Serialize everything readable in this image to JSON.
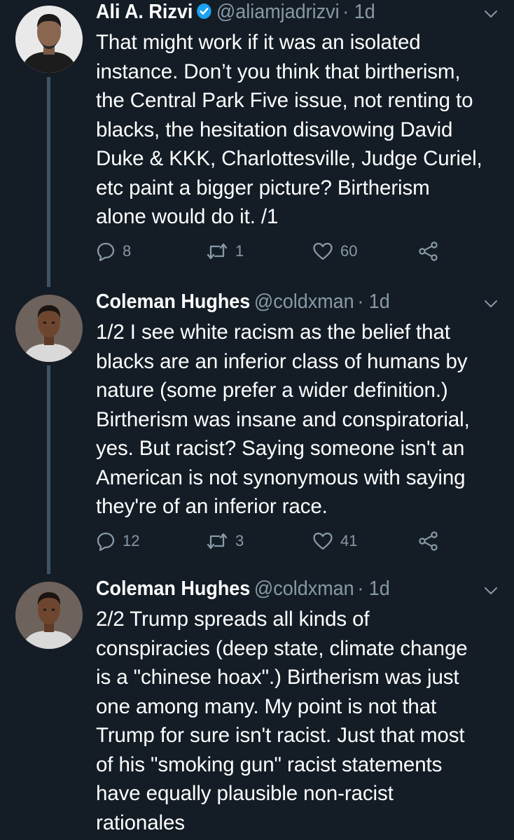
{
  "tweets": [
    {
      "name": "Ali A. Rizvi",
      "verified": true,
      "handle": "@aliamjadrizvi",
      "time": "· 1d",
      "text": "That might work if it was an isolated\ninstance. Don’t you think that birtherism,\nthe Central Park Five issue, not renting to\nblacks, the hesitation disavowing David\nDuke & KKK, Charlottesville, Judge Curiel,\netc paint a bigger picture? Birtherism\nalone would do it. /1",
      "replies": "8",
      "retweets": "1",
      "likes": "60"
    },
    {
      "name": "Coleman Hughes",
      "verified": false,
      "handle": "@coldxman",
      "time": "· 1d",
      "text": "1/2 I see white racism as the belief that\nblacks are an inferior class of humans by\nnature (some prefer a wider definition.)\nBirtherism was insane and conspiratorial,\nyes. But racist? Saying someone isn't an\nAmerican is not synonymous with saying\nthey're of an inferior race.",
      "replies": "12",
      "retweets": "3",
      "likes": "41"
    },
    {
      "name": "Coleman Hughes",
      "verified": false,
      "handle": "@coldxman",
      "time": "· 1d",
      "text": "2/2 Trump spreads all kinds of\nconspiracies (deep state, climate change\nis a \"chinese hoax\".) Birtherism was just\none among many. My point is not that\nTrump for sure isn't racist. Just that most\nof his \"smoking gun\" racist statements\nhave equally plausible non-racist\nrationales"
    }
  ],
  "colors": {
    "background": "#141d26",
    "text": "#ffffff",
    "muted": "#8899a6",
    "thread_line": "#3d5466",
    "verified": "#1da1f2"
  },
  "icons": {
    "reply": "reply-icon",
    "retweet": "retweet-icon",
    "like": "heart-icon",
    "share": "share-icon",
    "menu": "chevron-down-icon",
    "verified": "verified-badge-icon"
  }
}
